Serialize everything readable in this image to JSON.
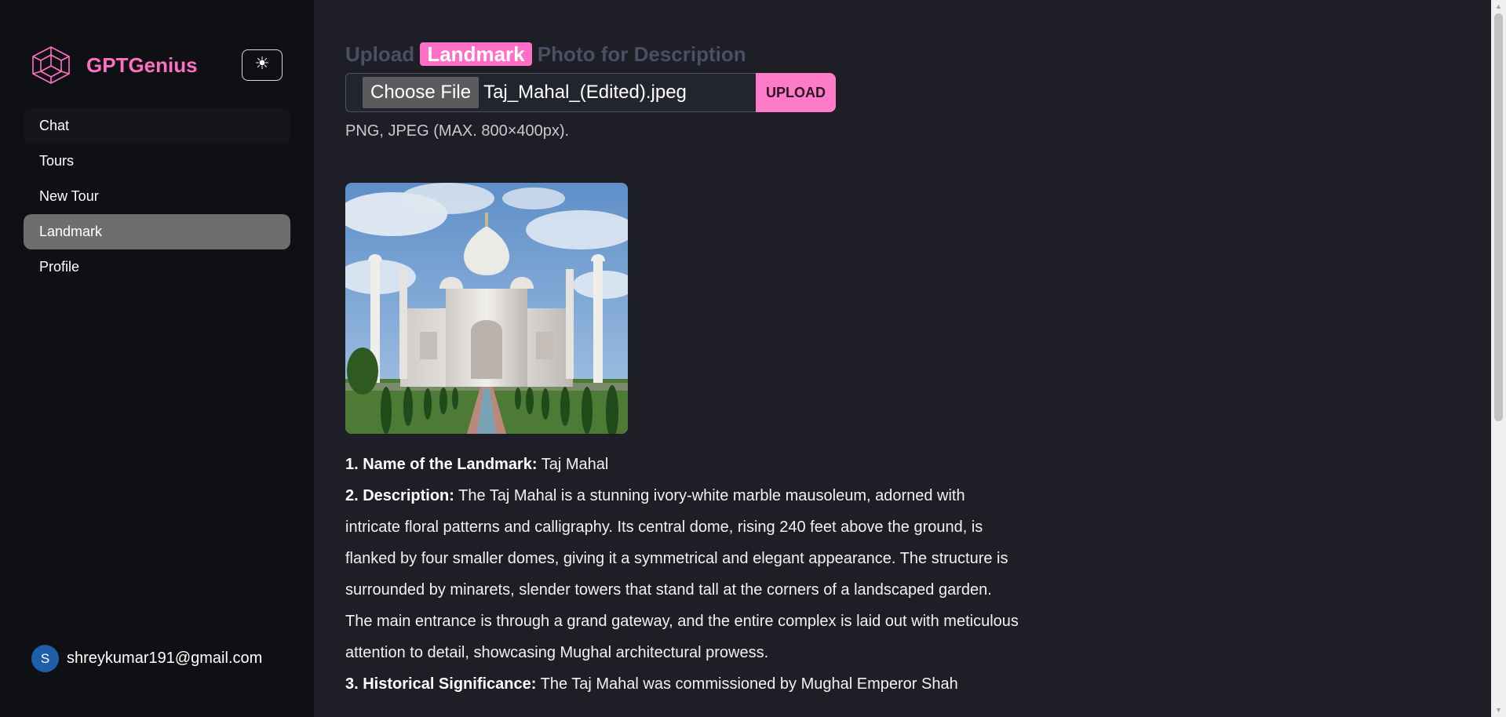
{
  "app": {
    "name": "GPTGenius",
    "brand_color": "#ff6fc5",
    "theme_toggle_icon": "☀"
  },
  "sidebar": {
    "items": [
      {
        "label": "Chat",
        "state": "hover"
      },
      {
        "label": "Tours",
        "state": "normal"
      },
      {
        "label": "New Tour",
        "state": "normal"
      },
      {
        "label": "Landmark",
        "state": "active"
      },
      {
        "label": "Profile",
        "state": "normal"
      }
    ],
    "user": {
      "initial": "S",
      "email": "shreykumar191@gmail.com"
    }
  },
  "main": {
    "heading": {
      "before": "Upload ",
      "highlight": "Landmark",
      "after": " Photo for Description"
    },
    "file_input": {
      "button_label": "Choose File",
      "file_name": "Taj_Mahal_(Edited).jpeg"
    },
    "upload_label": "UPLOAD",
    "hint": "PNG, JPEG (MAX. 800×400px).",
    "image_alt": "Taj Mahal photo",
    "description": [
      {
        "label": "1. Name of the Landmark:",
        "text": " Taj Mahal"
      },
      {
        "label": "2. Description:",
        "text": " The Taj Mahal is a stunning ivory-white marble mausoleum, adorned with intricate floral patterns and calligraphy. Its central dome, rising 240 feet above the ground, is flanked by four smaller domes, giving it a symmetrical and elegant appearance. The structure is surrounded by minarets, slender towers that stand tall at the corners of a landscaped garden. The main entrance is through a grand gateway, and the entire complex is laid out with meticulous attention to detail, showcasing Mughal architectural prowess."
      },
      {
        "label": "3. Historical Significance:",
        "text": " The Taj Mahal was commissioned by Mughal Emperor Shah"
      }
    ]
  }
}
